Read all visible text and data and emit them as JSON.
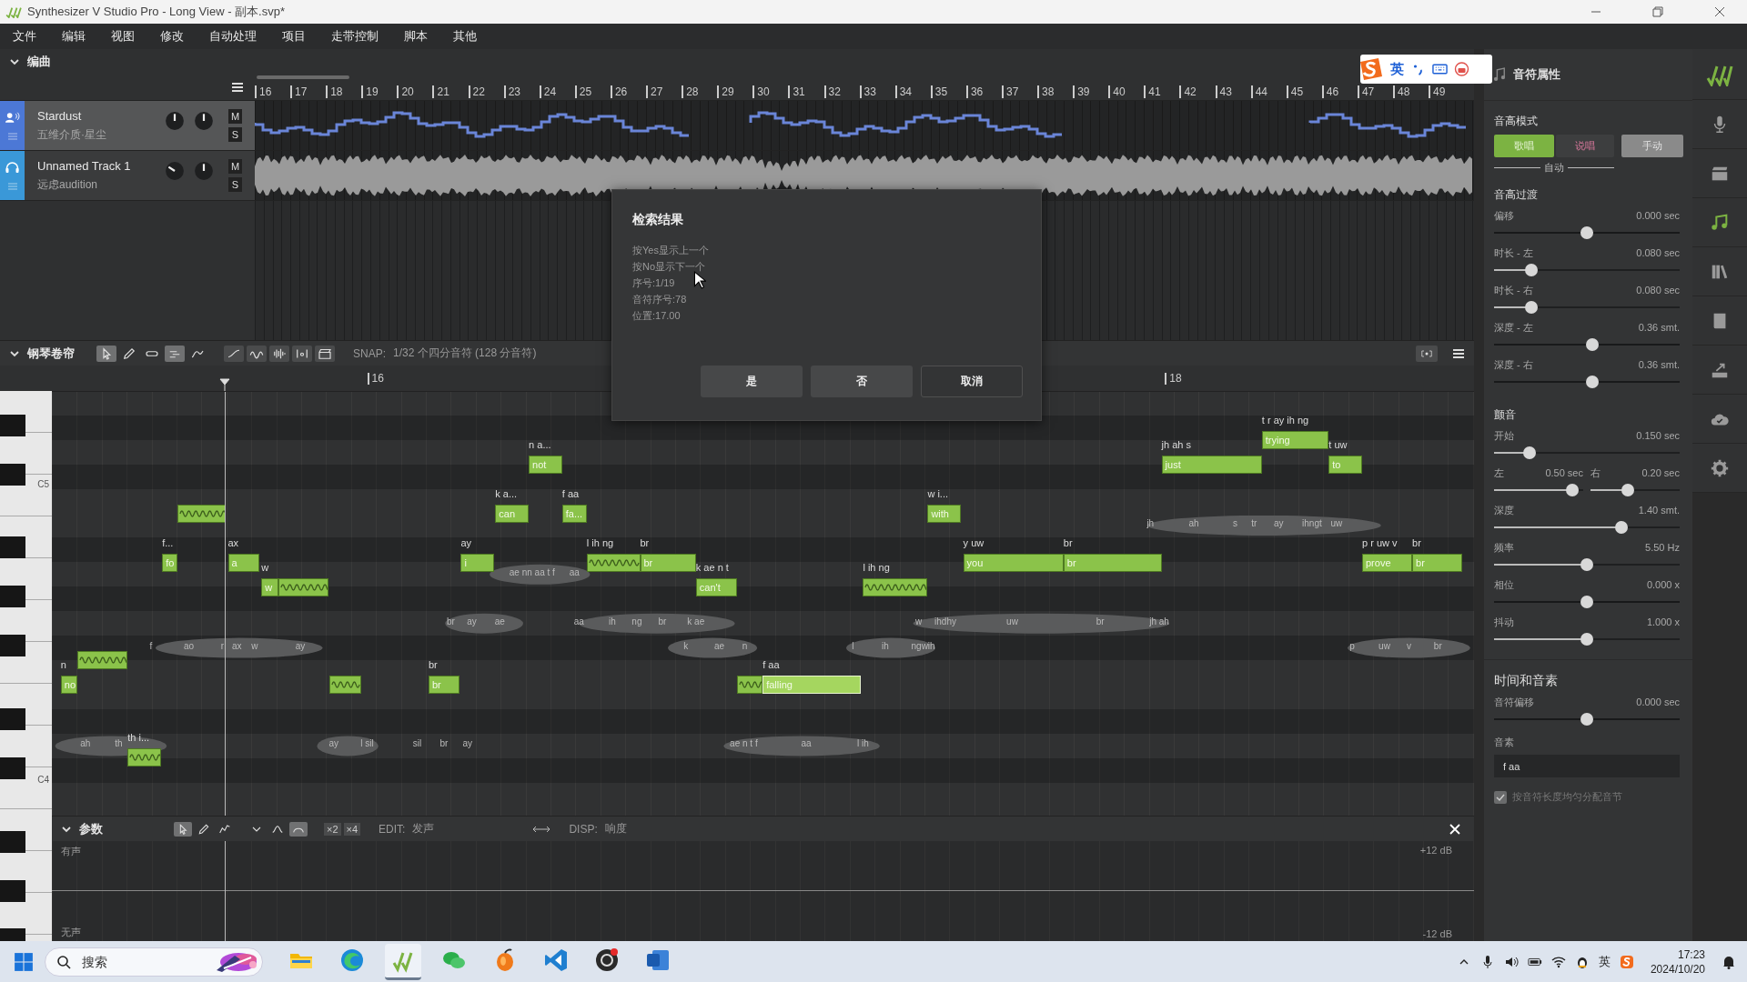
{
  "window": {
    "title": "Synthesizer V Studio Pro - Long View - 副本.svp*"
  },
  "menu": [
    "文件",
    "编辑",
    "视图",
    "修改",
    "自动处理",
    "项目",
    "走带控制",
    "脚本",
    "其他"
  ],
  "ime_bar": {
    "mode": "英"
  },
  "arrangement": {
    "title": "编曲",
    "ruler": [
      "16",
      "17",
      "18",
      "19",
      "20",
      "21",
      "22",
      "23",
      "24",
      "25",
      "26",
      "27",
      "28",
      "29",
      "30",
      "31",
      "32",
      "33",
      "34",
      "35",
      "36",
      "37",
      "38",
      "39",
      "40",
      "41",
      "42",
      "43",
      "44",
      "45",
      "46",
      "47",
      "48",
      "49"
    ],
    "tracks": [
      {
        "name": "Stardust",
        "subtitle": "五维介质·星尘",
        "kind": "vocal",
        "selected": true,
        "mute": "M",
        "solo": "S"
      },
      {
        "name": "Unnamed Track 1",
        "subtitle": "远虑audition",
        "kind": "audio",
        "selected": false,
        "mute": "M",
        "solo": "S"
      }
    ]
  },
  "piano_roll": {
    "title": "钢琴卷帘",
    "tools": [
      {
        "selected": true
      },
      {
        "selected": false
      },
      {
        "selected": false
      },
      {
        "selected": true
      },
      {
        "selected": false
      }
    ],
    "snap_label": "SNAP:",
    "snap_value": "1/32 个四分音符 (128 分音符)",
    "ruler": [
      "16",
      "18"
    ],
    "keyboard": [
      "C5",
      "C4"
    ],
    "notes": [
      {
        "kind": "word",
        "lyric": "no",
        "phonemes": "n",
        "selected": false
      },
      {
        "kind": "slur",
        "selected": false
      },
      {
        "kind": "slur",
        "phonemes": "th i...",
        "selected": false
      },
      {
        "kind": "word",
        "lyric": "fo",
        "phonemes": "f...",
        "selected": false
      },
      {
        "kind": "slur",
        "selected": false
      },
      {
        "kind": "word",
        "lyric": "a",
        "phonemes": "ax",
        "selected": false
      },
      {
        "kind": "word",
        "lyric": "w",
        "phonemes": "w",
        "selected": false
      },
      {
        "kind": "slur",
        "selected": false
      },
      {
        "kind": "slur",
        "selected": false
      },
      {
        "kind": "word",
        "lyric": "br",
        "phonemes": "br",
        "selected": false
      },
      {
        "kind": "word",
        "lyric": "i",
        "phonemes": "ay",
        "selected": false
      },
      {
        "kind": "word",
        "lyric": "can",
        "phonemes": "k a...",
        "selected": false
      },
      {
        "kind": "word",
        "lyric": "not",
        "phonemes": "n a...",
        "selected": false
      },
      {
        "kind": "word",
        "lyric": "fa...",
        "phonemes": "f aa",
        "selected": false
      },
      {
        "kind": "slur",
        "phonemes": "l ih ng",
        "selected": false
      },
      {
        "kind": "word",
        "lyric": "br",
        "phonemes": "br",
        "selected": false
      },
      {
        "kind": "word",
        "lyric": "can't",
        "phonemes": "k ae n t",
        "selected": false
      },
      {
        "kind": "slur",
        "selected": false
      },
      {
        "kind": "word",
        "lyric": "falling",
        "phonemes": "f aa",
        "selected": true
      },
      {
        "kind": "slur",
        "phonemes": "l ih ng",
        "selected": false
      },
      {
        "kind": "word",
        "lyric": "with",
        "phonemes": "w i...",
        "selected": false
      },
      {
        "kind": "word",
        "lyric": "you",
        "phonemes": "y uw",
        "selected": false
      },
      {
        "kind": "word",
        "lyric": "br",
        "phonemes": "br",
        "selected": false
      },
      {
        "kind": "word",
        "lyric": "just",
        "phonemes": "jh ah s",
        "selected": false
      },
      {
        "kind": "word",
        "lyric": "trying",
        "phonemes": "t r ay ih ng",
        "selected": false
      },
      {
        "kind": "word",
        "lyric": "to",
        "phonemes": "t uw",
        "selected": false
      },
      {
        "kind": "word",
        "lyric": "prove",
        "phonemes": "p r uw v",
        "selected": false
      },
      {
        "kind": "word",
        "lyric": "br",
        "phonemes": "br",
        "selected": false
      }
    ],
    "phoneme_labels": [
      "ah",
      "th",
      "f",
      "ao",
      "r",
      "ax",
      "w",
      "ay",
      "ay",
      "l sil",
      "sil",
      "br",
      "ay",
      "br",
      "ay",
      "ae",
      "ae nn aa t f",
      "aa",
      "aa",
      "ih",
      "ng",
      "br",
      "k ae",
      "k",
      "ae",
      "n",
      "ae n t f",
      "aa",
      "l ih",
      "l",
      "ih",
      "ngwih",
      "w",
      "ihdhy",
      "uw",
      "br",
      "jh ah",
      "jh",
      "ah",
      "s",
      "tr",
      "ay",
      "ihngt",
      "uw",
      "p",
      "uw",
      "v",
      "br"
    ]
  },
  "params": {
    "title": "参数",
    "tools": [
      {
        "selected": true
      },
      {
        "selected": false
      },
      {
        "selected": false
      },
      {
        "selected": false
      },
      {
        "selected": false
      },
      {
        "selected": true
      }
    ],
    "multipliers": [
      "×2",
      "×4"
    ],
    "edit_label": "EDIT:",
    "edit_value": "发声",
    "disp_label": "DISP:",
    "disp_value": "响度",
    "top_label": "有声",
    "bottom_label": "无声",
    "top_value": "+12 dB",
    "bottom_value": "-12 dB"
  },
  "dialog": {
    "title": "检索结果",
    "lines": [
      "按Yes显示上一个",
      "按No显示下一个",
      "序号:1/19",
      "音符序号:78",
      "位置:17.00"
    ],
    "buttons": [
      {
        "label": "是",
        "kind": "filled"
      },
      {
        "label": "否",
        "kind": "filled"
      },
      {
        "label": "取消",
        "kind": "outlined"
      }
    ]
  },
  "note_properties": {
    "title": "音符属性",
    "pitch_mode": {
      "title": "音高模式",
      "options": [
        {
          "label": "歌唱",
          "selected": true
        },
        {
          "label": "说唱",
          "selected": false
        },
        {
          "label": "手动",
          "selected": false
        }
      ],
      "auto_label": "自动"
    },
    "sections": [
      {
        "title": "音高过渡",
        "sliders": [
          {
            "kind": "centered",
            "label": "偏移",
            "value": "0.000 sec",
            "level": 0.5
          },
          {
            "kind": "fill",
            "label": "时长 - 左",
            "value": "0.080 sec",
            "level": 0.18
          },
          {
            "kind": "fill",
            "label": "时长 - 右",
            "value": "0.080 sec",
            "level": 0.18
          },
          {
            "kind": "centered",
            "label": "深度 - 左",
            "value": "0.36 smt.",
            "level": 0.53
          },
          {
            "kind": "centered",
            "label": "深度 - 右",
            "value": "0.36 smt.",
            "level": 0.53
          }
        ]
      },
      {
        "title": "颤音",
        "sliders": [
          {
            "kind": "fill",
            "label": "开始",
            "value": "0.150 sec",
            "level": 0.17
          },
          {
            "kind": "pair",
            "left": {
              "label": "左",
              "value": "0.50 sec",
              "level": 0.94
            },
            "right": {
              "label": "右",
              "value": "0.20 sec",
              "level": 0.4
            }
          },
          {
            "kind": "fill",
            "label": "深度",
            "value": "1.40 smt.",
            "level": 0.7
          },
          {
            "kind": "fill",
            "label": "频率",
            "value": "5.50 Hz",
            "level": 0.5
          },
          {
            "kind": "centered",
            "label": "相位",
            "value": "0.000 x",
            "level": 0.5
          },
          {
            "kind": "fill",
            "label": "抖动",
            "value": "1.000 x",
            "level": 0.5
          }
        ]
      }
    ],
    "timing": {
      "title": "时间和音素",
      "sliders": [
        {
          "kind": "centered",
          "label": "音符偏移",
          "value": "0.000 sec",
          "level": 0.5
        }
      ],
      "phoneme_label": "音素",
      "phoneme_value": "f aa",
      "checkbox_label": "按音符长度均匀分配音节",
      "checked": true
    }
  },
  "sidebar": [
    {
      "selected": false
    },
    {
      "selected": false
    },
    {
      "selected": true
    },
    {
      "selected": false
    },
    {
      "selected": false
    },
    {
      "selected": false
    },
    {
      "selected": false
    },
    {
      "selected": false
    }
  ],
  "taskbar": {
    "search_placeholder": "搜索",
    "apps": [
      {
        "selected": false
      },
      {
        "selected": false
      },
      {
        "selected": true
      },
      {
        "selected": false
      },
      {
        "selected": false
      },
      {
        "selected": false
      },
      {
        "selected": false
      },
      {
        "selected": false
      }
    ],
    "ime": "英",
    "time": "17:23",
    "date": "2024/10/20"
  }
}
